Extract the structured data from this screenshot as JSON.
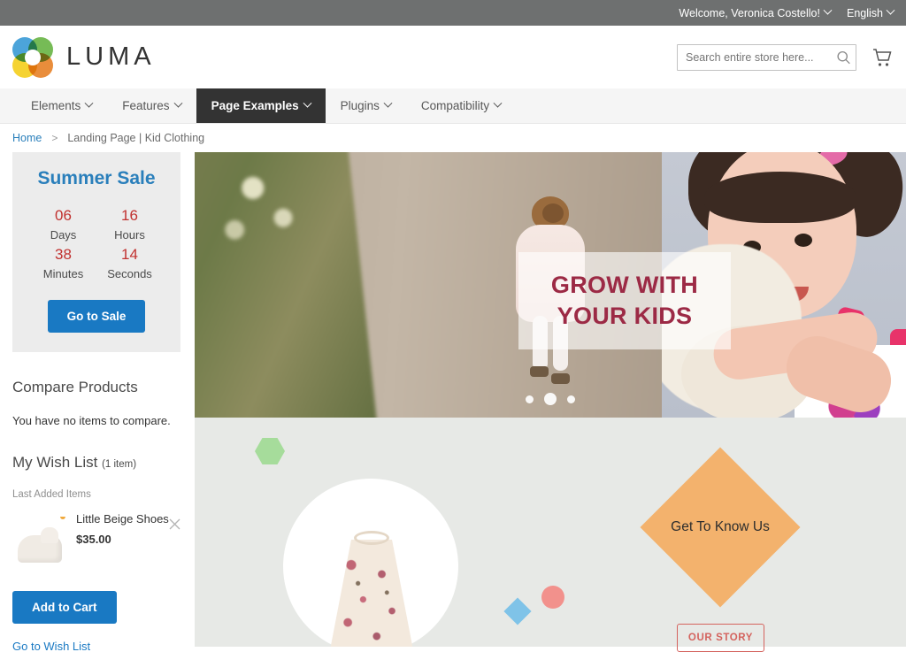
{
  "topbar": {
    "welcome": "Welcome, Veronica Costello!",
    "language": "English",
    "caret_icon": "chevron-down-icon"
  },
  "header": {
    "brand": "LUMA",
    "logo_icon": "luma-logo-icon",
    "search": {
      "placeholder": "Search entire store here...",
      "value": "",
      "icon": "search-icon"
    },
    "cart_icon": "shopping-cart-icon"
  },
  "nav": {
    "items": [
      {
        "label": "Elements",
        "active": false
      },
      {
        "label": "Features",
        "active": false
      },
      {
        "label": "Page Examples",
        "active": true
      },
      {
        "label": "Plugins",
        "active": false
      },
      {
        "label": "Compatibility",
        "active": false
      }
    ]
  },
  "breadcrumb": {
    "home": "Home",
    "separator": ">",
    "current": "Landing Page | Kid Clothing"
  },
  "sidebar": {
    "countdown": {
      "title": "Summer Sale",
      "units": [
        {
          "value": "06",
          "label": "Days"
        },
        {
          "value": "16",
          "label": "Hours"
        },
        {
          "value": "38",
          "label": "Minutes"
        },
        {
          "value": "14",
          "label": "Seconds"
        }
      ],
      "cta": "Go to Sale"
    },
    "compare": {
      "title": "Compare Products",
      "empty_text": "You have no items to compare."
    },
    "wishlist": {
      "title": "My Wish List",
      "count": "(1 item)",
      "last_added_label": "Last Added Items",
      "item": {
        "name": "Little Beige Shoes",
        "price": "$35.00",
        "remove_icon": "close-icon",
        "thumb_icon": "beige-shoe-thumbnail"
      },
      "add_to_cart": "Add to Cart",
      "go_to_wishlist": "Go to Wish List"
    }
  },
  "hero": {
    "caption_line1": "GROW WITH",
    "caption_line2": "YOUR KIDS",
    "dots": [
      {
        "active": false
      },
      {
        "active": true
      },
      {
        "active": false
      }
    ]
  },
  "promo": {
    "know_us": "Get To Know Us",
    "our_story": "OUR STORY",
    "shapes": {
      "hexagon": "green-hexagon-icon",
      "diamond": "blue-diamond-icon",
      "circle": "pink-circle-icon",
      "product": "floral-dress-image"
    }
  },
  "colors": {
    "topbar_grey": "#6e7070",
    "accent_blue": "#1979c3",
    "link_blue": "#2a7fbb",
    "countdown_red": "#c1312f",
    "hero_text_red": "#9c2a45",
    "nav_active_dark": "#333333",
    "promo_bg": "#e7e9e6",
    "diamond_orange": "#f3b26d",
    "story_red": "#d4635e",
    "hexagon_green": "#a6dc9b"
  }
}
